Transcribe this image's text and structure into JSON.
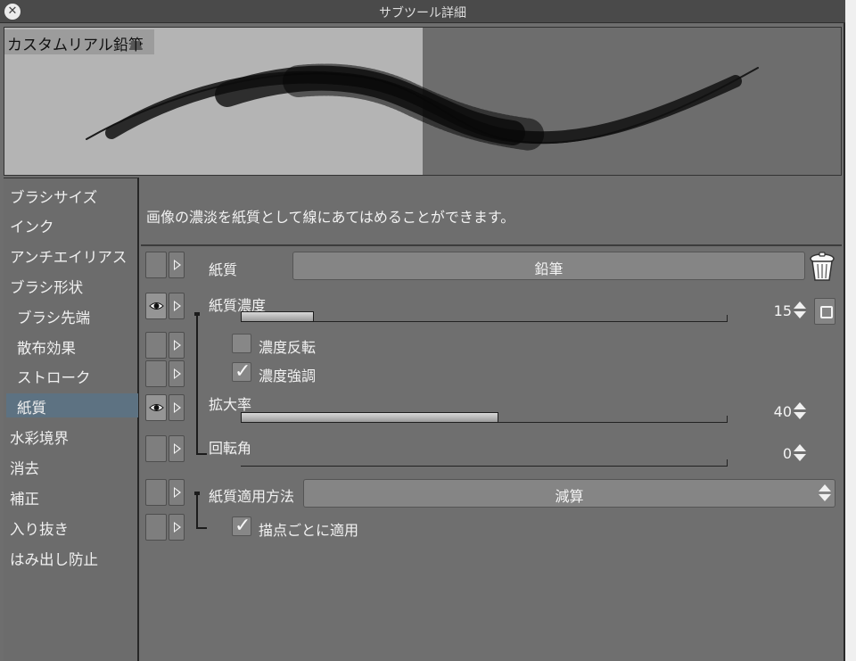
{
  "window": {
    "title": "サブツール詳細"
  },
  "preview": {
    "tool_name": "カスタムリアル鉛筆"
  },
  "categories": [
    {
      "label": "ブラシサイズ",
      "sub": false,
      "selected": false
    },
    {
      "label": "インク",
      "sub": false,
      "selected": false
    },
    {
      "label": "アンチエイリアス",
      "sub": false,
      "selected": false
    },
    {
      "label": "ブラシ形状",
      "sub": false,
      "selected": false
    },
    {
      "label": "ブラシ先端",
      "sub": true,
      "selected": false
    },
    {
      "label": "散布効果",
      "sub": true,
      "selected": false
    },
    {
      "label": "ストローク",
      "sub": true,
      "selected": false
    },
    {
      "label": "紙質",
      "sub": true,
      "selected": true
    },
    {
      "label": "水彩境界",
      "sub": false,
      "selected": false
    },
    {
      "label": "消去",
      "sub": false,
      "selected": false
    },
    {
      "label": "補正",
      "sub": false,
      "selected": false
    },
    {
      "label": "入り抜き",
      "sub": false,
      "selected": false
    },
    {
      "label": "はみ出し防止",
      "sub": false,
      "selected": false
    }
  ],
  "description": "画像の濃淡を紙質として線にあてはめることができます。",
  "properties": {
    "paper": {
      "label": "紙質",
      "value": "鉛筆"
    },
    "density": {
      "label": "紙質濃度",
      "value": "15",
      "level": 0.15
    },
    "invert": {
      "label": "濃度反転",
      "checked": false
    },
    "emphasize": {
      "label": "濃度強調",
      "checked": true
    },
    "scale": {
      "label": "拡大率",
      "value": "40",
      "level": 0.53
    },
    "rotation": {
      "label": "回転角",
      "value": "0",
      "level": 0
    },
    "method": {
      "label": "紙質適用方法",
      "value": "減算"
    },
    "per_dab": {
      "label": "描点ごとに適用",
      "checked": true
    }
  },
  "icons": {
    "close": "close-icon",
    "trash": "trash-icon",
    "eye": "eye-icon",
    "expand": "triangle-right-icon",
    "lock": "square-icon",
    "spin": "spin-arrows-icon",
    "check": "checkmark-icon"
  }
}
